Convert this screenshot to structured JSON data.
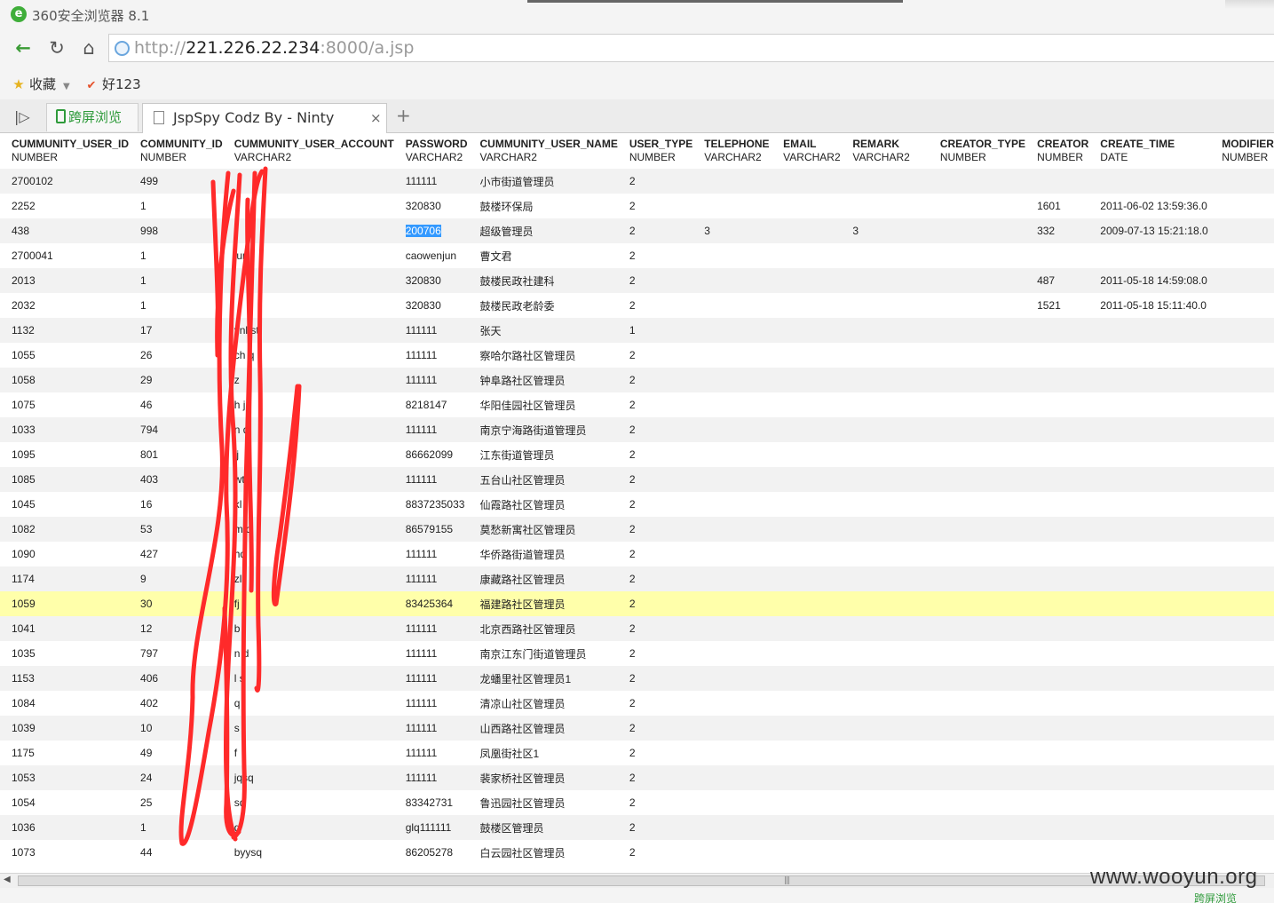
{
  "window": {
    "title": "360安全浏览器 8.1"
  },
  "nav": {
    "url_scheme": "http://",
    "url_host": "221.226.22.234",
    "url_rest": ":8000/a.jsp"
  },
  "bookmarks": {
    "favorites": "收藏",
    "hao123": "好123"
  },
  "tabs": {
    "screen_browse": "跨屏浏览",
    "active_tab": "JspSpy Codz By - Ninty",
    "close": "×",
    "new_tab": "+"
  },
  "table": {
    "columns": [
      {
        "name": "CUMMUNITY_USER_ID",
        "type": "NUMBER"
      },
      {
        "name": "COMMUNITY_ID",
        "type": "NUMBER"
      },
      {
        "name": "CUMMUNITY_USER_ACCOUNT",
        "type": "VARCHAR2"
      },
      {
        "name": "PASSWORD",
        "type": "VARCHAR2"
      },
      {
        "name": "CUMMUNITY_USER_NAME",
        "type": "VARCHAR2"
      },
      {
        "name": "USER_TYPE",
        "type": "NUMBER"
      },
      {
        "name": "TELEPHONE",
        "type": "VARCHAR2"
      },
      {
        "name": "EMAIL",
        "type": "VARCHAR2"
      },
      {
        "name": "REMARK",
        "type": "VARCHAR2"
      },
      {
        "name": "CREATOR_TYPE",
        "type": "NUMBER"
      },
      {
        "name": "CREATOR",
        "type": "NUMBER"
      },
      {
        "name": "CREATE_TIME",
        "type": "DATE"
      },
      {
        "name": "MODIFIER",
        "type": "NUMBER"
      }
    ],
    "rows": [
      [
        "2700102",
        "499",
        "",
        "111111",
        "小市街道管理员",
        "2",
        "",
        "",
        "",
        "",
        "",
        "",
        ""
      ],
      [
        "2252",
        "1",
        "",
        "320830",
        "鼓楼环保局",
        "2",
        "",
        "",
        "",
        "",
        "1601",
        "2011-06-02 13:59:36.0",
        ""
      ],
      [
        "438",
        "998",
        "",
        "200706",
        "超级管理员",
        "2",
        "3",
        "",
        "3",
        "",
        "332",
        "2009-07-13 15:21:18.0",
        ""
      ],
      [
        "2700041",
        "1",
        "jun",
        "caowenjun",
        "曹文君",
        "2",
        "",
        "",
        "",
        "",
        "",
        "",
        ""
      ],
      [
        "2013",
        "1",
        "",
        "320830",
        "鼓楼民政社建科",
        "2",
        "",
        "",
        "",
        "",
        "487",
        "2011-05-18 14:59:08.0",
        ""
      ],
      [
        "2032",
        "1",
        "",
        "320830",
        "鼓楼民政老龄委",
        "2",
        "",
        "",
        "",
        "",
        "1521",
        "2011-05-18 15:11:40.0",
        ""
      ],
      [
        "1132",
        "17",
        "ynl st",
        "111111",
        "张天",
        "1",
        "",
        "",
        "",
        "",
        "",
        "",
        ""
      ],
      [
        "1055",
        "26",
        "ch q",
        "111111",
        "察哈尔路社区管理员",
        "2",
        "",
        "",
        "",
        "",
        "",
        "",
        ""
      ],
      [
        "1058",
        "29",
        "z",
        "111111",
        "钟阜路社区管理员",
        "2",
        "",
        "",
        "",
        "",
        "",
        "",
        ""
      ],
      [
        "1075",
        "46",
        "h j",
        "8218147",
        "华阳佳园社区管理员",
        "2",
        "",
        "",
        "",
        "",
        "",
        "",
        ""
      ],
      [
        "1033",
        "794",
        "n d",
        "111111",
        "南京宁海路街道管理员",
        "2",
        "",
        "",
        "",
        "",
        "",
        "",
        ""
      ],
      [
        "1095",
        "801",
        "jj",
        "86662099",
        "江东街道管理员",
        "2",
        "",
        "",
        "",
        "",
        "",
        "",
        ""
      ],
      [
        "1085",
        "403",
        "wt",
        "111111",
        "五台山社区管理员",
        "2",
        "",
        "",
        "",
        "",
        "",
        "",
        ""
      ],
      [
        "1045",
        "16",
        "xl",
        "8837235033",
        "仙霞路社区管理员",
        "2",
        "",
        "",
        "",
        "",
        "",
        "",
        ""
      ],
      [
        "1082",
        "53",
        "m q",
        "86579155",
        "莫愁新寓社区管理员",
        "2",
        "",
        "",
        "",
        "",
        "",
        "",
        ""
      ],
      [
        "1090",
        "427",
        "hq",
        "111111",
        "华侨路街道管理员",
        "2",
        "",
        "",
        "",
        "",
        "",
        "",
        ""
      ],
      [
        "1174",
        "9",
        "zl",
        "111111",
        "康藏路社区管理员",
        "2",
        "",
        "",
        "",
        "",
        "",
        "",
        ""
      ],
      [
        "1059",
        "30",
        "fj",
        "83425364",
        "福建路社区管理员",
        "2",
        "",
        "",
        "",
        "",
        "",
        "",
        ""
      ],
      [
        "1041",
        "12",
        "b",
        "111111",
        "北京西路社区管理员",
        "2",
        "",
        "",
        "",
        "",
        "",
        "",
        ""
      ],
      [
        "1035",
        "797",
        "n d",
        "111111",
        "南京江东门街道管理员",
        "2",
        "",
        "",
        "",
        "",
        "",
        "",
        ""
      ],
      [
        "1153",
        "406",
        "l s",
        "111111",
        "龙蟠里社区管理员1",
        "2",
        "",
        "",
        "",
        "",
        "",
        "",
        ""
      ],
      [
        "1084",
        "402",
        "q",
        "111111",
        "清凉山社区管理员",
        "2",
        "",
        "",
        "",
        "",
        "",
        "",
        ""
      ],
      [
        "1039",
        "10",
        "s",
        "111111",
        "山西路社区管理员",
        "2",
        "",
        "",
        "",
        "",
        "",
        "",
        ""
      ],
      [
        "1175",
        "49",
        "f",
        "111111",
        "凤凰街社区1",
        "2",
        "",
        "",
        "",
        "",
        "",
        "",
        ""
      ],
      [
        "1053",
        "24",
        "jqsq",
        "111111",
        "裴家桥社区管理员",
        "2",
        "",
        "",
        "",
        "",
        "",
        "",
        ""
      ],
      [
        "1054",
        "25",
        "sq",
        "83342731",
        "鲁迅园社区管理员",
        "2",
        "",
        "",
        "",
        "",
        "",
        "",
        ""
      ],
      [
        "1036",
        "1",
        "g",
        "glq111111",
        "鼓楼区管理员",
        "2",
        "",
        "",
        "",
        "",
        "",
        "",
        ""
      ],
      [
        "1073",
        "44",
        "byysq",
        "86205278",
        "白云园社区管理员",
        "2",
        "",
        "",
        "",
        "",
        "",
        "",
        ""
      ]
    ],
    "highlight_row": 17,
    "selected_cell": {
      "row": 2,
      "col": 3
    }
  },
  "status": {
    "screen_browse": "跨屏浏览"
  },
  "watermark": "www.wooyun.org",
  "colors": {
    "accent_green": "#2f9b3b",
    "highlight_row": "#ffffaa",
    "selection": "#3399ff",
    "scribble": "#ff2a2a"
  }
}
